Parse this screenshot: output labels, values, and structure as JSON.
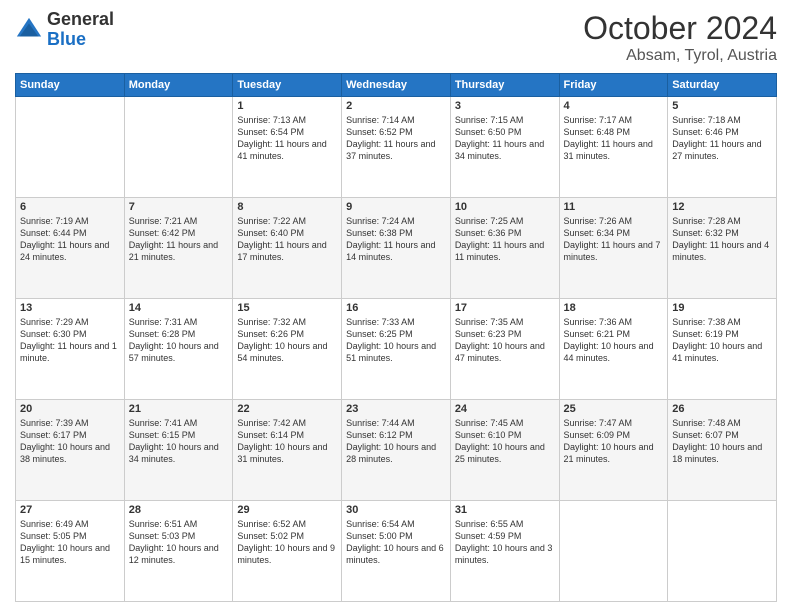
{
  "logo": {
    "general": "General",
    "blue": "Blue"
  },
  "header": {
    "month": "October 2024",
    "location": "Absam, Tyrol, Austria"
  },
  "weekdays": [
    "Sunday",
    "Monday",
    "Tuesday",
    "Wednesday",
    "Thursday",
    "Friday",
    "Saturday"
  ],
  "weeks": [
    [
      {
        "day": "",
        "sunrise": "",
        "sunset": "",
        "daylight": ""
      },
      {
        "day": "",
        "sunrise": "",
        "sunset": "",
        "daylight": ""
      },
      {
        "day": "1",
        "sunrise": "Sunrise: 7:13 AM",
        "sunset": "Sunset: 6:54 PM",
        "daylight": "Daylight: 11 hours and 41 minutes."
      },
      {
        "day": "2",
        "sunrise": "Sunrise: 7:14 AM",
        "sunset": "Sunset: 6:52 PM",
        "daylight": "Daylight: 11 hours and 37 minutes."
      },
      {
        "day": "3",
        "sunrise": "Sunrise: 7:15 AM",
        "sunset": "Sunset: 6:50 PM",
        "daylight": "Daylight: 11 hours and 34 minutes."
      },
      {
        "day": "4",
        "sunrise": "Sunrise: 7:17 AM",
        "sunset": "Sunset: 6:48 PM",
        "daylight": "Daylight: 11 hours and 31 minutes."
      },
      {
        "day": "5",
        "sunrise": "Sunrise: 7:18 AM",
        "sunset": "Sunset: 6:46 PM",
        "daylight": "Daylight: 11 hours and 27 minutes."
      }
    ],
    [
      {
        "day": "6",
        "sunrise": "Sunrise: 7:19 AM",
        "sunset": "Sunset: 6:44 PM",
        "daylight": "Daylight: 11 hours and 24 minutes."
      },
      {
        "day": "7",
        "sunrise": "Sunrise: 7:21 AM",
        "sunset": "Sunset: 6:42 PM",
        "daylight": "Daylight: 11 hours and 21 minutes."
      },
      {
        "day": "8",
        "sunrise": "Sunrise: 7:22 AM",
        "sunset": "Sunset: 6:40 PM",
        "daylight": "Daylight: 11 hours and 17 minutes."
      },
      {
        "day": "9",
        "sunrise": "Sunrise: 7:24 AM",
        "sunset": "Sunset: 6:38 PM",
        "daylight": "Daylight: 11 hours and 14 minutes."
      },
      {
        "day": "10",
        "sunrise": "Sunrise: 7:25 AM",
        "sunset": "Sunset: 6:36 PM",
        "daylight": "Daylight: 11 hours and 11 minutes."
      },
      {
        "day": "11",
        "sunrise": "Sunrise: 7:26 AM",
        "sunset": "Sunset: 6:34 PM",
        "daylight": "Daylight: 11 hours and 7 minutes."
      },
      {
        "day": "12",
        "sunrise": "Sunrise: 7:28 AM",
        "sunset": "Sunset: 6:32 PM",
        "daylight": "Daylight: 11 hours and 4 minutes."
      }
    ],
    [
      {
        "day": "13",
        "sunrise": "Sunrise: 7:29 AM",
        "sunset": "Sunset: 6:30 PM",
        "daylight": "Daylight: 11 hours and 1 minute."
      },
      {
        "day": "14",
        "sunrise": "Sunrise: 7:31 AM",
        "sunset": "Sunset: 6:28 PM",
        "daylight": "Daylight: 10 hours and 57 minutes."
      },
      {
        "day": "15",
        "sunrise": "Sunrise: 7:32 AM",
        "sunset": "Sunset: 6:26 PM",
        "daylight": "Daylight: 10 hours and 54 minutes."
      },
      {
        "day": "16",
        "sunrise": "Sunrise: 7:33 AM",
        "sunset": "Sunset: 6:25 PM",
        "daylight": "Daylight: 10 hours and 51 minutes."
      },
      {
        "day": "17",
        "sunrise": "Sunrise: 7:35 AM",
        "sunset": "Sunset: 6:23 PM",
        "daylight": "Daylight: 10 hours and 47 minutes."
      },
      {
        "day": "18",
        "sunrise": "Sunrise: 7:36 AM",
        "sunset": "Sunset: 6:21 PM",
        "daylight": "Daylight: 10 hours and 44 minutes."
      },
      {
        "day": "19",
        "sunrise": "Sunrise: 7:38 AM",
        "sunset": "Sunset: 6:19 PM",
        "daylight": "Daylight: 10 hours and 41 minutes."
      }
    ],
    [
      {
        "day": "20",
        "sunrise": "Sunrise: 7:39 AM",
        "sunset": "Sunset: 6:17 PM",
        "daylight": "Daylight: 10 hours and 38 minutes."
      },
      {
        "day": "21",
        "sunrise": "Sunrise: 7:41 AM",
        "sunset": "Sunset: 6:15 PM",
        "daylight": "Daylight: 10 hours and 34 minutes."
      },
      {
        "day": "22",
        "sunrise": "Sunrise: 7:42 AM",
        "sunset": "Sunset: 6:14 PM",
        "daylight": "Daylight: 10 hours and 31 minutes."
      },
      {
        "day": "23",
        "sunrise": "Sunrise: 7:44 AM",
        "sunset": "Sunset: 6:12 PM",
        "daylight": "Daylight: 10 hours and 28 minutes."
      },
      {
        "day": "24",
        "sunrise": "Sunrise: 7:45 AM",
        "sunset": "Sunset: 6:10 PM",
        "daylight": "Daylight: 10 hours and 25 minutes."
      },
      {
        "day": "25",
        "sunrise": "Sunrise: 7:47 AM",
        "sunset": "Sunset: 6:09 PM",
        "daylight": "Daylight: 10 hours and 21 minutes."
      },
      {
        "day": "26",
        "sunrise": "Sunrise: 7:48 AM",
        "sunset": "Sunset: 6:07 PM",
        "daylight": "Daylight: 10 hours and 18 minutes."
      }
    ],
    [
      {
        "day": "27",
        "sunrise": "Sunrise: 6:49 AM",
        "sunset": "Sunset: 5:05 PM",
        "daylight": "Daylight: 10 hours and 15 minutes."
      },
      {
        "day": "28",
        "sunrise": "Sunrise: 6:51 AM",
        "sunset": "Sunset: 5:03 PM",
        "daylight": "Daylight: 10 hours and 12 minutes."
      },
      {
        "day": "29",
        "sunrise": "Sunrise: 6:52 AM",
        "sunset": "Sunset: 5:02 PM",
        "daylight": "Daylight: 10 hours and 9 minutes."
      },
      {
        "day": "30",
        "sunrise": "Sunrise: 6:54 AM",
        "sunset": "Sunset: 5:00 PM",
        "daylight": "Daylight: 10 hours and 6 minutes."
      },
      {
        "day": "31",
        "sunrise": "Sunrise: 6:55 AM",
        "sunset": "Sunset: 4:59 PM",
        "daylight": "Daylight: 10 hours and 3 minutes."
      },
      {
        "day": "",
        "sunrise": "",
        "sunset": "",
        "daylight": ""
      },
      {
        "day": "",
        "sunrise": "",
        "sunset": "",
        "daylight": ""
      }
    ]
  ]
}
